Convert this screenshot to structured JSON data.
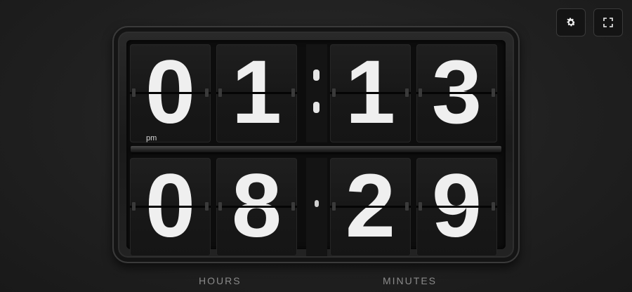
{
  "clock": {
    "meridiem": "pm",
    "hours_row": [
      "0",
      "1",
      "1",
      "3"
    ],
    "minutes_row": [
      "0",
      "8",
      "2",
      "9"
    ]
  },
  "labels": {
    "hours": "HOURS",
    "minutes": "MINUTES"
  },
  "toolbar": {
    "settings_icon": "gear-icon",
    "fullscreen_icon": "fullscreen-icon"
  },
  "colors": {
    "background": "#222222",
    "digit": "#efefef",
    "label": "#8a8a8a"
  }
}
